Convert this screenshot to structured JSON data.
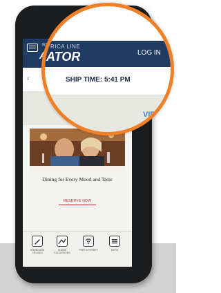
{
  "header": {
    "brand_line": "RICA LINE",
    "brand_name": "ATOR",
    "login_label": "LOG IN"
  },
  "ship_time": {
    "label": "SHIP TIME:",
    "value": "5:41 PM"
  },
  "promo": {
    "view_label": "VIEW"
  },
  "card": {
    "text": "Dining for Every Mood and Taste",
    "reserve_label": "RESERVE NOW"
  },
  "tabbar": {
    "items": [
      {
        "label": "SHIPBOARD CRUISES",
        "icon": "pen-icon"
      },
      {
        "label": "SHORE EXCURSIONS",
        "icon": "map-icon"
      },
      {
        "label": "FREE INTERNET",
        "icon": "wifi-icon"
      },
      {
        "label": "MORE",
        "icon": "menu-icon"
      }
    ]
  },
  "colors": {
    "accent": "#f07f26",
    "navy": "#1f3a63",
    "link": "#3f7bc7",
    "reserve": "#b23232"
  }
}
